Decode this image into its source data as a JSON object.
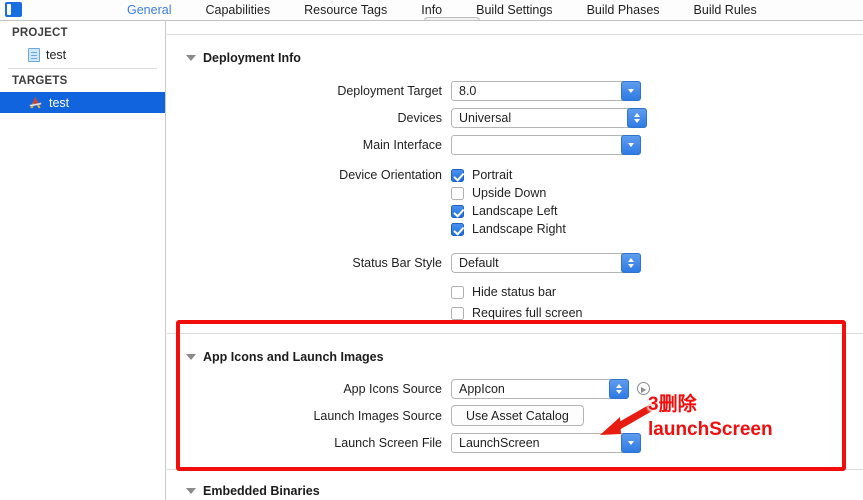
{
  "window": {
    "nav_toggle_icon": "navigator-toggle-icon"
  },
  "tabbar": {
    "tabs": [
      {
        "label": "General",
        "active": true
      },
      {
        "label": "Capabilities",
        "active": false
      },
      {
        "label": "Resource Tags",
        "active": false
      },
      {
        "label": "Info",
        "active": false
      },
      {
        "label": "Build Settings",
        "active": false
      },
      {
        "label": "Build Phases",
        "active": false
      },
      {
        "label": "Build Rules",
        "active": false
      }
    ],
    "active_tab_color": "#3b7edd"
  },
  "sidebar": {
    "project_header": "PROJECT",
    "project_items": [
      {
        "label": "test",
        "icon": "project-file-icon"
      }
    ],
    "targets_header": "TARGETS",
    "target_items": [
      {
        "label": "test",
        "icon": "app-target-icon",
        "selected": true
      }
    ],
    "selection_color": "#1263de"
  },
  "deployment_info": {
    "title": "Deployment Info",
    "deployment_target": {
      "label": "Deployment Target",
      "value": "8.0"
    },
    "devices": {
      "label": "Devices",
      "value": "Universal"
    },
    "main_interface": {
      "label": "Main Interface",
      "value": ""
    },
    "device_orientation": {
      "label": "Device Orientation",
      "options": [
        {
          "label": "Portrait",
          "checked": true
        },
        {
          "label": "Upside Down",
          "checked": false
        },
        {
          "label": "Landscape Left",
          "checked": true
        },
        {
          "label": "Landscape Right",
          "checked": true
        }
      ]
    },
    "status_bar_style": {
      "label": "Status Bar Style",
      "value": "Default"
    },
    "hide_status_bar": {
      "label": "Hide status bar",
      "checked": false
    },
    "requires_full_screen": {
      "label": "Requires full screen",
      "checked": false
    }
  },
  "app_icons": {
    "title": "App Icons and Launch Images",
    "app_icons_source": {
      "label": "App Icons Source",
      "value": "AppIcon"
    },
    "launch_images_source": {
      "label": "Launch Images Source",
      "button": "Use Asset Catalog"
    },
    "launch_screen_file": {
      "label": "Launch Screen File",
      "value": "LaunchScreen"
    }
  },
  "embedded_binaries": {
    "title": "Embedded Binaries"
  },
  "annotation": {
    "line1": "3删除",
    "line2": "launchScreen",
    "color": "#f20d0d",
    "arrow": "red-arrow-icon",
    "box": "red-highlight-box"
  }
}
